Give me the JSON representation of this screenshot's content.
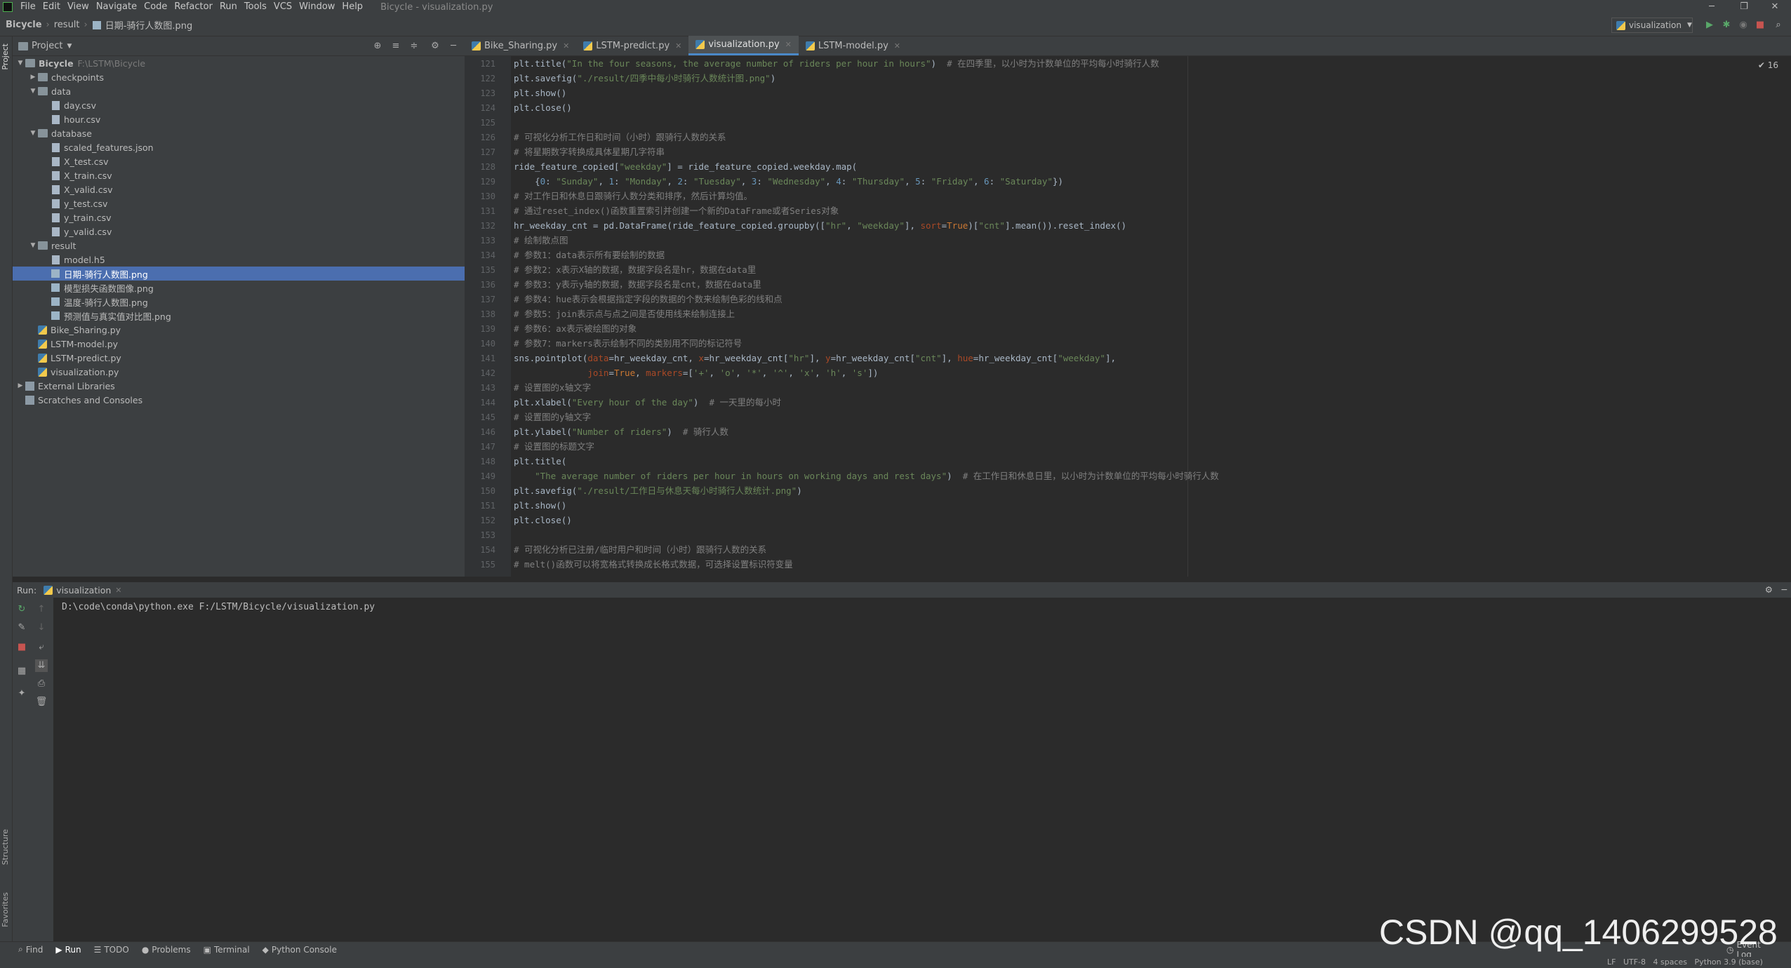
{
  "menubar": {
    "items": [
      "File",
      "Edit",
      "View",
      "Navigate",
      "Code",
      "Refactor",
      "Run",
      "Tools",
      "VCS",
      "Window",
      "Help"
    ],
    "window_title": "Bicycle - visualization.py"
  },
  "navbar": {
    "project": "Bicycle",
    "folder": "result",
    "file": "日期-骑行人数图.png",
    "run_config": "visualization"
  },
  "project_panel": {
    "title": "Project",
    "tree": [
      {
        "label": "Bicycle",
        "extra": "F:\\LSTM\\Bicycle",
        "type": "folder",
        "level": 0,
        "open": true,
        "bold": true
      },
      {
        "label": "checkpoints",
        "type": "folder",
        "level": 1,
        "open": false
      },
      {
        "label": "data",
        "type": "folder",
        "level": 1,
        "open": true
      },
      {
        "label": "day.csv",
        "type": "file",
        "level": 2
      },
      {
        "label": "hour.csv",
        "type": "file",
        "level": 2
      },
      {
        "label": "database",
        "type": "folder",
        "level": 1,
        "open": true
      },
      {
        "label": "scaled_features.json",
        "type": "file",
        "level": 2
      },
      {
        "label": "X_test.csv",
        "type": "file",
        "level": 2
      },
      {
        "label": "X_train.csv",
        "type": "file",
        "level": 2
      },
      {
        "label": "X_valid.csv",
        "type": "file",
        "level": 2
      },
      {
        "label": "y_test.csv",
        "type": "file",
        "level": 2
      },
      {
        "label": "y_train.csv",
        "type": "file",
        "level": 2
      },
      {
        "label": "y_valid.csv",
        "type": "file",
        "level": 2
      },
      {
        "label": "result",
        "type": "folder",
        "level": 1,
        "open": true
      },
      {
        "label": "model.h5",
        "type": "file",
        "level": 2
      },
      {
        "label": "日期-骑行人数图.png",
        "type": "img",
        "level": 2,
        "selected": true
      },
      {
        "label": "模型损失函数图像.png",
        "type": "img",
        "level": 2
      },
      {
        "label": "温度-骑行人数图.png",
        "type": "img",
        "level": 2
      },
      {
        "label": "预测值与真实值对比图.png",
        "type": "img",
        "level": 2
      },
      {
        "label": "Bike_Sharing.py",
        "type": "py",
        "level": 1
      },
      {
        "label": "LSTM-model.py",
        "type": "py",
        "level": 1
      },
      {
        "label": "LSTM-predict.py",
        "type": "py",
        "level": 1
      },
      {
        "label": "visualization.py",
        "type": "py",
        "level": 1
      },
      {
        "label": "External Libraries",
        "type": "lib",
        "level": 0,
        "open": false
      },
      {
        "label": "Scratches and Consoles",
        "type": "lib",
        "level": 0
      }
    ]
  },
  "editor": {
    "tabs": [
      {
        "label": "Bike_Sharing.py",
        "active": false
      },
      {
        "label": "LSTM-predict.py",
        "active": false
      },
      {
        "label": "visualization.py",
        "active": true
      },
      {
        "label": "LSTM-model.py",
        "active": false
      }
    ],
    "inspection": "✔ 16",
    "lines": [
      {
        "n": "121",
        "c": [
          [
            "",
            "plt.title("
          ],
          [
            "st",
            "\"In the four seasons, the average number of riders per hour in hours\""
          ],
          [
            "",
            ")  "
          ],
          [
            "cm",
            "# 在四季里，以小时为计数单位的平均每小时骑行人数"
          ]
        ]
      },
      {
        "n": "122",
        "c": [
          [
            "",
            "plt.savefig("
          ],
          [
            "st",
            "\"./result/四季中每小时骑行人数统计图.png\""
          ],
          [
            "",
            ")"
          ]
        ]
      },
      {
        "n": "123",
        "c": [
          [
            "",
            "plt.show()"
          ]
        ]
      },
      {
        "n": "124",
        "c": [
          [
            "",
            "plt.close()"
          ]
        ]
      },
      {
        "n": "125",
        "c": []
      },
      {
        "n": "126",
        "c": [
          [
            "cm",
            "# 可视化分析工作日和时间（小时）跟骑行人数的关系"
          ]
        ]
      },
      {
        "n": "127",
        "c": [
          [
            "cm",
            "# 将星期数字转换成具体星期几字符串"
          ]
        ]
      },
      {
        "n": "128",
        "c": [
          [
            "",
            "ride_feature_copied["
          ],
          [
            "st",
            "\"weekday\""
          ],
          [
            "",
            "] = ride_feature_copied.weekday.map("
          ]
        ]
      },
      {
        "n": "129",
        "c": [
          [
            "",
            "    {"
          ],
          [
            "nm",
            "0"
          ],
          [
            "",
            ": "
          ],
          [
            "st",
            "\"Sunday\""
          ],
          [
            "",
            ", "
          ],
          [
            "nm",
            "1"
          ],
          [
            "",
            ": "
          ],
          [
            "st",
            "\"Monday\""
          ],
          [
            "",
            ", "
          ],
          [
            "nm",
            "2"
          ],
          [
            "",
            ": "
          ],
          [
            "st",
            "\"Tuesday\""
          ],
          [
            "",
            ", "
          ],
          [
            "nm",
            "3"
          ],
          [
            "",
            ": "
          ],
          [
            "st",
            "\"Wednesday\""
          ],
          [
            "",
            ", "
          ],
          [
            "nm",
            "4"
          ],
          [
            "",
            ": "
          ],
          [
            "st",
            "\"Thursday\""
          ],
          [
            "",
            ", "
          ],
          [
            "nm",
            "5"
          ],
          [
            "",
            ": "
          ],
          [
            "st",
            "\"Friday\""
          ],
          [
            "",
            ", "
          ],
          [
            "nm",
            "6"
          ],
          [
            "",
            ": "
          ],
          [
            "st",
            "\"Saturday\""
          ],
          [
            "",
            "})"
          ]
        ]
      },
      {
        "n": "130",
        "c": [
          [
            "cm",
            "# 对工作日和休息日跟骑行人数分类和排序，然后计算均值。"
          ]
        ]
      },
      {
        "n": "131",
        "c": [
          [
            "cm",
            "# 通过reset_index()函数重置索引并创建一个新的DataFrame或者Series对象"
          ]
        ]
      },
      {
        "n": "132",
        "c": [
          [
            "",
            "hr_weekday_cnt = pd.DataFrame(ride_feature_copied.groupby(["
          ],
          [
            "st",
            "\"hr\""
          ],
          [
            "",
            ", "
          ],
          [
            "st",
            "\"weekday\""
          ],
          [
            "",
            "], "
          ],
          [
            "pa",
            "sort"
          ],
          [
            "",
            "="
          ],
          [
            "kw",
            "True"
          ],
          [
            "",
            ")["
          ],
          [
            "st",
            "\"cnt\""
          ],
          [
            "",
            "].mean()).reset_index()"
          ]
        ]
      },
      {
        "n": "133",
        "c": [
          [
            "cm",
            "# 绘制散点图"
          ]
        ]
      },
      {
        "n": "134",
        "c": [
          [
            "cm",
            "# 参数1：data表示所有要绘制的数据"
          ]
        ]
      },
      {
        "n": "135",
        "c": [
          [
            "cm",
            "# 参数2：x表示X轴的数据，数据字段名是hr，数据在data里"
          ]
        ]
      },
      {
        "n": "136",
        "c": [
          [
            "cm",
            "# 参数3：y表示y轴的数据，数据字段名是cnt，数据在data里"
          ]
        ]
      },
      {
        "n": "137",
        "c": [
          [
            "cm",
            "# 参数4：hue表示会根据指定字段的数据的个数来绘制色彩的线和点"
          ]
        ]
      },
      {
        "n": "138",
        "c": [
          [
            "cm",
            "# 参数5：join表示点与点之间是否使用线来绘制连接上"
          ]
        ]
      },
      {
        "n": "139",
        "c": [
          [
            "cm",
            "# 参数6：ax表示被绘图的对象"
          ]
        ]
      },
      {
        "n": "140",
        "c": [
          [
            "cm",
            "# 参数7：markers表示绘制不同的类别用不同的标记符号"
          ]
        ]
      },
      {
        "n": "141",
        "c": [
          [
            "",
            "sns.pointplot("
          ],
          [
            "pa",
            "data"
          ],
          [
            "",
            "=hr_weekday_cnt, "
          ],
          [
            "pa",
            "x"
          ],
          [
            "",
            "=hr_weekday_cnt["
          ],
          [
            "st",
            "\"hr\""
          ],
          [
            "",
            "], "
          ],
          [
            "pa",
            "y"
          ],
          [
            "",
            "=hr_weekday_cnt["
          ],
          [
            "st",
            "\"cnt\""
          ],
          [
            "",
            "], "
          ],
          [
            "pa",
            "hue"
          ],
          [
            "",
            "=hr_weekday_cnt["
          ],
          [
            "st",
            "\"weekday\""
          ],
          [
            "",
            "],"
          ]
        ]
      },
      {
        "n": "142",
        "c": [
          [
            "",
            "              "
          ],
          [
            "pa",
            "join"
          ],
          [
            "",
            "="
          ],
          [
            "kw",
            "True"
          ],
          [
            "",
            ", "
          ],
          [
            "pa",
            "markers"
          ],
          [
            "",
            "=["
          ],
          [
            "st",
            "'+'"
          ],
          [
            "",
            ", "
          ],
          [
            "st",
            "'o'"
          ],
          [
            "",
            ", "
          ],
          [
            "st",
            "'*'"
          ],
          [
            "",
            ", "
          ],
          [
            "st",
            "'^'"
          ],
          [
            "",
            ", "
          ],
          [
            "st",
            "'x'"
          ],
          [
            "",
            ", "
          ],
          [
            "st",
            "'h'"
          ],
          [
            "",
            ", "
          ],
          [
            "st",
            "'s'"
          ],
          [
            "",
            "])"
          ]
        ]
      },
      {
        "n": "143",
        "c": [
          [
            "cm",
            "# 设置图的x轴文字"
          ]
        ]
      },
      {
        "n": "144",
        "c": [
          [
            "",
            "plt.xlabel("
          ],
          [
            "st",
            "\"Every hour of the day\""
          ],
          [
            "",
            ")  "
          ],
          [
            "cm",
            "# 一天里的每小时"
          ]
        ]
      },
      {
        "n": "145",
        "c": [
          [
            "cm",
            "# 设置图的y轴文字"
          ]
        ]
      },
      {
        "n": "146",
        "c": [
          [
            "",
            "plt.ylabel("
          ],
          [
            "st",
            "\"Number of riders\""
          ],
          [
            "",
            ")  "
          ],
          [
            "cm",
            "# 骑行人数"
          ]
        ]
      },
      {
        "n": "147",
        "c": [
          [
            "cm",
            "# 设置图的标题文字"
          ]
        ]
      },
      {
        "n": "148",
        "c": [
          [
            "",
            "plt.title("
          ]
        ]
      },
      {
        "n": "149",
        "c": [
          [
            "",
            "    "
          ],
          [
            "st",
            "\"The average number of riders per hour in hours on working days and rest days\""
          ],
          [
            "",
            ")  "
          ],
          [
            "cm",
            "# 在工作日和休息日里，以小时为计数单位的平均每小时骑行人数"
          ]
        ]
      },
      {
        "n": "150",
        "c": [
          [
            "",
            "plt.savefig("
          ],
          [
            "st",
            "\"./result/工作日与休息天每小时骑行人数统计.png\""
          ],
          [
            "",
            ")"
          ]
        ]
      },
      {
        "n": "151",
        "c": [
          [
            "",
            "plt.show()"
          ]
        ]
      },
      {
        "n": "152",
        "c": [
          [
            "",
            "plt.close()"
          ]
        ]
      },
      {
        "n": "153",
        "c": []
      },
      {
        "n": "154",
        "c": [
          [
            "cm",
            "# 可视化分析已注册/临时用户和时间（小时）跟骑行人数的关系"
          ]
        ]
      },
      {
        "n": "155",
        "c": [
          [
            "cm",
            "# melt()函数可以将宽格式转换成长格式数据，可选择设置标识符变量"
          ]
        ]
      }
    ]
  },
  "run_panel": {
    "label": "Run:",
    "tab": "visualization",
    "console": "D:\\code\\conda\\python.exe F:/LSTM/Bicycle/visualization.py"
  },
  "bottombar": {
    "items": [
      "Find",
      "Run",
      "TODO",
      "Problems",
      "Terminal",
      "Python Console"
    ],
    "event_log": "Event Log"
  },
  "statusbar": {
    "text": "LF   UTF-8   4 spaces   Python 3.9 (base)"
  },
  "side_labels": {
    "project": "Project",
    "structure": "Structure",
    "favorites": "Favorites"
  },
  "watermark": "CSDN @qq_1406299528"
}
